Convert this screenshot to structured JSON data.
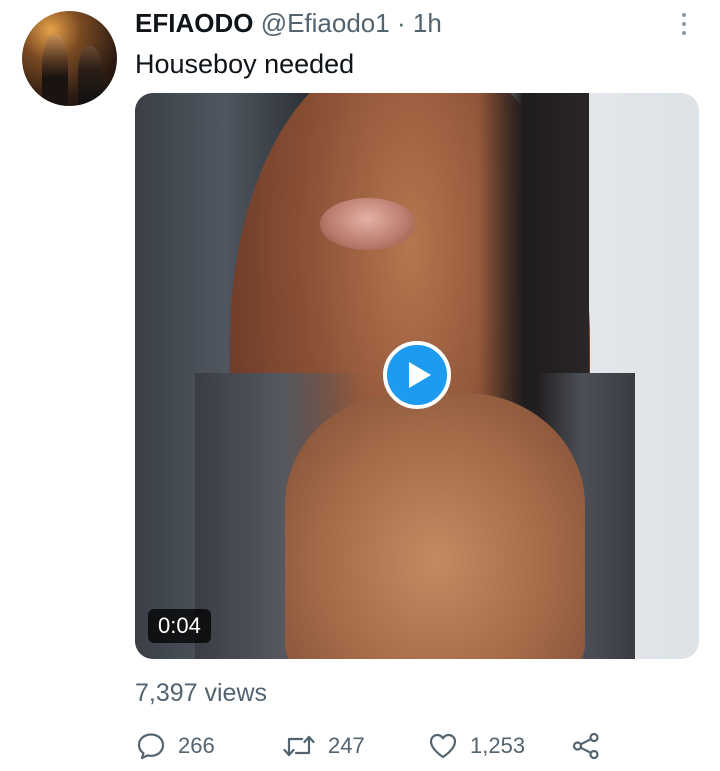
{
  "author": {
    "display_name": "EFIAODO",
    "handle": "@Efiaodo1",
    "separator": "·",
    "time": "1h"
  },
  "tweet": {
    "text": "Houseboy needed"
  },
  "media": {
    "duration": "0:04"
  },
  "stats": {
    "views": "7,397 views"
  },
  "actions": {
    "reply_count": "266",
    "retweet_count": "247",
    "like_count": "1,253"
  },
  "colors": {
    "accent": "#1d9bf0",
    "secondary_text": "#536471"
  },
  "icons": {
    "more": "more-vertical-icon",
    "play": "play-icon",
    "reply": "reply-icon",
    "retweet": "retweet-icon",
    "like": "heart-icon",
    "share": "share-icon"
  }
}
